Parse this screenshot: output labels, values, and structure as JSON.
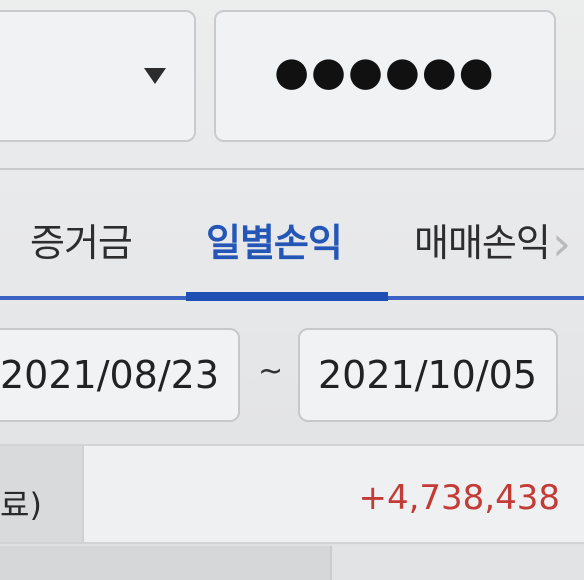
{
  "top": {
    "select_icon": "chevron-down-icon",
    "password_dots": "●●●●●●"
  },
  "tabs": [
    {
      "label": "증거금",
      "active": false
    },
    {
      "label": "일별손익",
      "active": true
    },
    {
      "label": "매매손익",
      "active": false
    }
  ],
  "tab_next_icon": "chevron-right-icon",
  "date_range": {
    "start": "2021/08/23",
    "separator": "~",
    "end": "2021/10/05"
  },
  "summary": {
    "label": "료)",
    "value": "+4,738,438"
  },
  "colors": {
    "accent_blue": "#2456b8",
    "positive_red": "#c23b36"
  }
}
